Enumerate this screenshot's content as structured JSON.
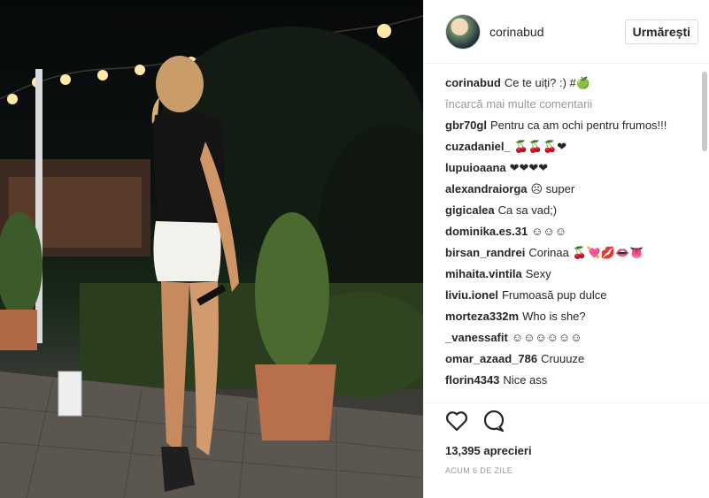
{
  "post": {
    "username": "corinabud",
    "follow_label": "Urmărești"
  },
  "caption": {
    "username": "corinabud",
    "text": "Ce te uiți? :) #🍏"
  },
  "load_more": "încarcă mai multe comentarii",
  "comments": [
    {
      "user": "gbr70gl",
      "text": "Pentru ca am ochi pentru frumos!!!"
    },
    {
      "user": "cuzadaniel_",
      "text": "🍒🍒🍒❤"
    },
    {
      "user": "lupuioaana",
      "text": "❤❤❤❤"
    },
    {
      "user": "alexandraiorga",
      "text": "☹ super"
    },
    {
      "user": "gigicalea",
      "text": "Ca sa vad;)"
    },
    {
      "user": "dominika.es.31",
      "text": "☺☺☺"
    },
    {
      "user": "birsan_randrei",
      "text": "Corinaa 🍒💘💋👄👅"
    },
    {
      "user": "mihaita.vintila",
      "text": "Sexy"
    },
    {
      "user": "liviu.ionel",
      "text": "Frumoasă pup dulce"
    },
    {
      "user": "morteza332m",
      "text": "Who is she?"
    },
    {
      "user": "_vanessafit",
      "text": "☺☺☺☺☺☺"
    },
    {
      "user": "omar_azaad_786",
      "text": "Cruuuze"
    },
    {
      "user": "florin4343",
      "text": "Nice ass"
    }
  ],
  "icons": {
    "like": "heart-icon",
    "comment": "comment-icon"
  },
  "likes_text": "13,395 aprecieri",
  "timestamp": "ACUM 6 DE ZILE",
  "colors": {
    "text": "#262626",
    "muted": "#999999",
    "border": "#efefef"
  }
}
